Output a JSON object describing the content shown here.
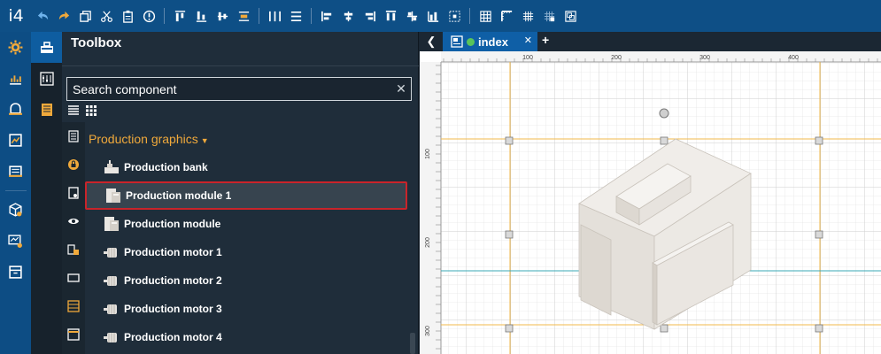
{
  "app": {
    "logo": "i4"
  },
  "toolbox": {
    "title": "Toolbox",
    "search_placeholder": "Search component",
    "clear_glyph": "✕",
    "group": "Production graphics",
    "components": [
      {
        "label": "Production bank",
        "icon": "production-bank-icon",
        "selected": false
      },
      {
        "label": "Production module 1",
        "icon": "production-module-icon",
        "selected": true
      },
      {
        "label": "Production module",
        "icon": "production-module-icon",
        "selected": false
      },
      {
        "label": "Production motor 1",
        "icon": "production-motor-icon",
        "selected": false
      },
      {
        "label": "Production motor 2",
        "icon": "production-motor-icon",
        "selected": false
      },
      {
        "label": "Production motor 3",
        "icon": "production-motor-icon",
        "selected": false
      },
      {
        "label": "Production motor 4",
        "icon": "production-motor-icon",
        "selected": false
      }
    ]
  },
  "editor": {
    "tab_label": "index",
    "tab_status_color": "#59c45a",
    "ruler": {
      "horizontal_labels": [
        "100",
        "200",
        "300",
        "400"
      ],
      "vertical_labels": [
        "100",
        "200",
        "300"
      ]
    }
  },
  "colors": {
    "topbar": "#0e4f86",
    "accent": "#0f5fa6",
    "group_header": "#f0a93b",
    "selection_border": "#c9242a",
    "guide_orange": "#f2b94b",
    "guide_teal": "#3aa9b4"
  }
}
